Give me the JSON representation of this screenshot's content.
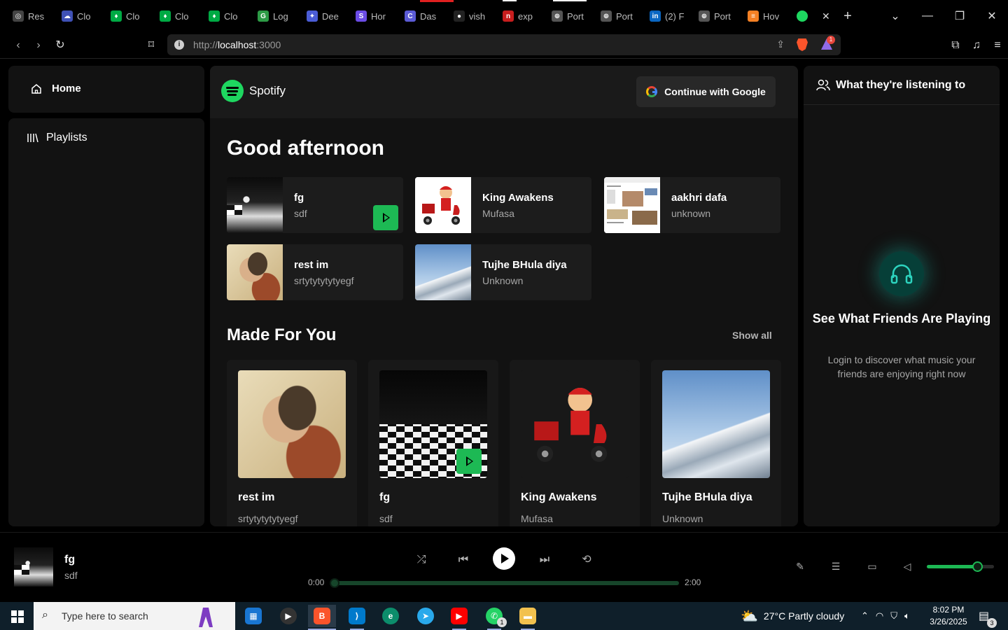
{
  "browser": {
    "tabs": [
      {
        "label": "Res",
        "fav_color": "#444",
        "fav_glyph": "◎"
      },
      {
        "label": "Clo",
        "fav_color": "#3f51b5",
        "fav_glyph": "☁"
      },
      {
        "label": "Clo",
        "fav_color": "#0a4",
        "fav_glyph": "♦"
      },
      {
        "label": "Clo",
        "fav_color": "#0a4",
        "fav_glyph": "♦"
      },
      {
        "label": "Clo",
        "fav_color": "#0a4",
        "fav_glyph": "♦"
      },
      {
        "label": "Log",
        "fav_color": "#2d9b46",
        "fav_glyph": "G"
      },
      {
        "label": "Dee",
        "fav_color": "#4a5cd6",
        "fav_glyph": "✦"
      },
      {
        "label": "Hor",
        "fav_color": "#6b4ce6",
        "fav_glyph": "S"
      },
      {
        "label": "Das",
        "fav_color": "#5b5bd6",
        "fav_glyph": "C"
      },
      {
        "label": "vish",
        "fav_color": "#222",
        "fav_glyph": "●"
      },
      {
        "label": "exp",
        "fav_color": "#c81e1e",
        "fav_glyph": "n"
      },
      {
        "label": "Port",
        "fav_color": "#555",
        "fav_glyph": "⊕"
      },
      {
        "label": "Port",
        "fav_color": "#555",
        "fav_glyph": "⊕"
      },
      {
        "label": "(2) F",
        "fav_color": "#0a66c2",
        "fav_glyph": "in"
      },
      {
        "label": "Port",
        "fav_color": "#555",
        "fav_glyph": "⊕"
      },
      {
        "label": "Hov",
        "fav_color": "#f48024",
        "fav_glyph": "≡"
      }
    ],
    "active_tab_close": "✕",
    "new_tab": "+",
    "url_prefix": "http://",
    "url_host": "localhost",
    "url_port": ":3000",
    "rewards_badge": "1"
  },
  "sidebar": {
    "home_label": "Home",
    "playlists_label": "Playlists"
  },
  "header": {
    "brand": "Spotify",
    "google_button": "Continue with Google"
  },
  "main": {
    "greeting": "Good afternoon",
    "quick_picks": [
      {
        "title": "fg",
        "subtitle": "sdf",
        "art": "fg"
      },
      {
        "title": "King Awakens",
        "subtitle": "Mufasa",
        "art": "king"
      },
      {
        "title": "aakhri dafa",
        "subtitle": "unknown",
        "art": "web"
      },
      {
        "title": "rest im",
        "subtitle": "srtytytytytyegf",
        "art": "anime"
      },
      {
        "title": "Tujhe BHula diya",
        "subtitle": "Unknown",
        "art": "mount"
      }
    ],
    "made_for_you": {
      "title": "Made For You",
      "show_all": "Show all",
      "cards": [
        {
          "title": "rest im",
          "subtitle": "srtytytytytyegf",
          "art": "anime"
        },
        {
          "title": "fg",
          "subtitle": "sdf",
          "art": "fg2"
        },
        {
          "title": "King Awakens",
          "subtitle": "Mufasa",
          "art": "king"
        },
        {
          "title": "Tujhe BHula diya",
          "subtitle": "Unknown",
          "art": "mount"
        }
      ]
    }
  },
  "friends": {
    "heading": "What they're listening to",
    "title": "See What Friends Are Playing",
    "subtitle": "Login to discover what music your friends are enjoying right now"
  },
  "player": {
    "track_title": "fg",
    "track_artist": "sdf",
    "time_current": "0:00",
    "time_total": "2:00",
    "progress": 0,
    "volume": 0.75
  },
  "taskbar": {
    "search_placeholder": "Type here to search",
    "weather": "27°C  Partly cloudy",
    "time": "8:02 PM",
    "date": "3/26/2025",
    "whatsapp_badge": "1",
    "notification_badge": "3"
  },
  "colors": {
    "accent": "#1db954",
    "panel": "#121212",
    "friends_glow": "#14b8a6"
  }
}
